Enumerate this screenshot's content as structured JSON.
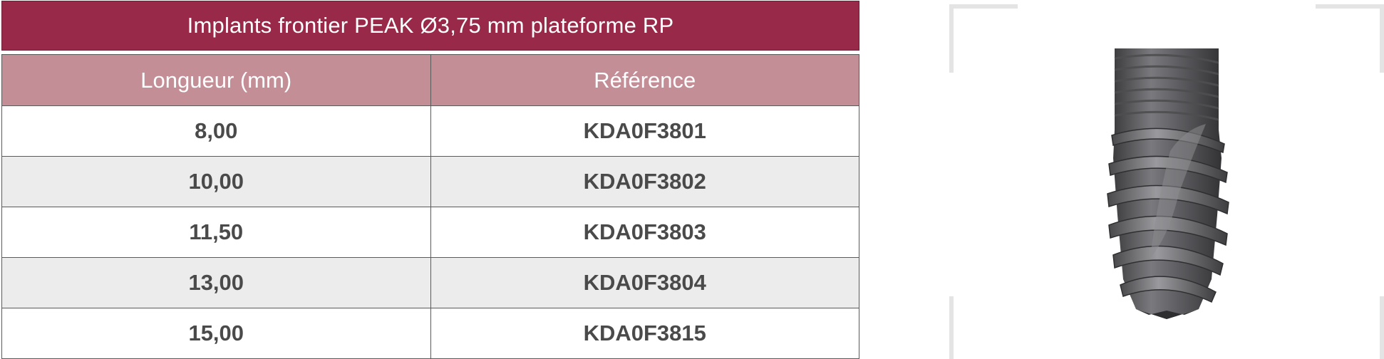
{
  "table": {
    "title": "Implants frontier PEAK Ø3,75 mm plateforme RP",
    "headers": {
      "length": "Longueur (mm)",
      "reference": "Référence"
    },
    "rows": [
      {
        "length": "8,00",
        "reference": "KDA0F3801"
      },
      {
        "length": "10,00",
        "reference": "KDA0F3802"
      },
      {
        "length": "11,50",
        "reference": "KDA0F3803"
      },
      {
        "length": "13,00",
        "reference": "KDA0F3804"
      },
      {
        "length": "15,00",
        "reference": "KDA0F3815"
      }
    ]
  },
  "colors": {
    "title_bg": "#982948",
    "header_bg": "#c48e97",
    "alt_row_bg": "#ececec",
    "text": "#4a4a4a"
  }
}
